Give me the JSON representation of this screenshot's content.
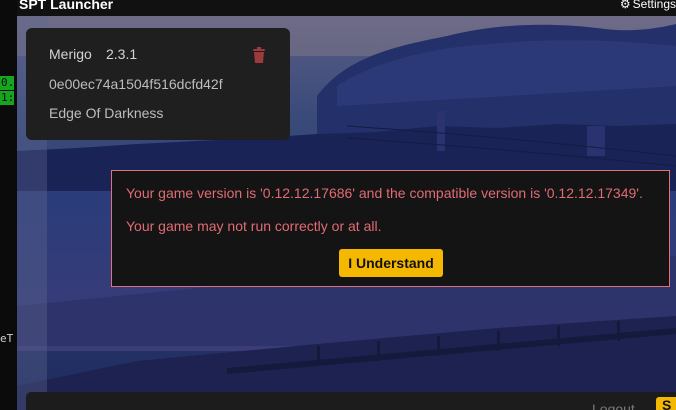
{
  "terminal": {
    "line1": "0.",
    "line2": "1:",
    "tail": "eT"
  },
  "window": {
    "title": "SPT Launcher",
    "settings_label": "Settings"
  },
  "profile": {
    "name": "Merigo",
    "version": "2.3.1",
    "id": "0e00ec74a1504f516dcfd42f",
    "edition": "Edge Of Darkness"
  },
  "dialog": {
    "message1": "Your game version is '0.12.12.17686' and the compatible version is '0.12.12.17349'.",
    "message2": "Your game may not run correctly or at all.",
    "button_label": "I Understand"
  },
  "bottombar": {
    "logout_label": "Logout",
    "start_label": "S"
  },
  "colors": {
    "accent": "#f5b800",
    "warning": "#e06b74",
    "card": "#1f1f1f",
    "dialog": "#141414"
  }
}
